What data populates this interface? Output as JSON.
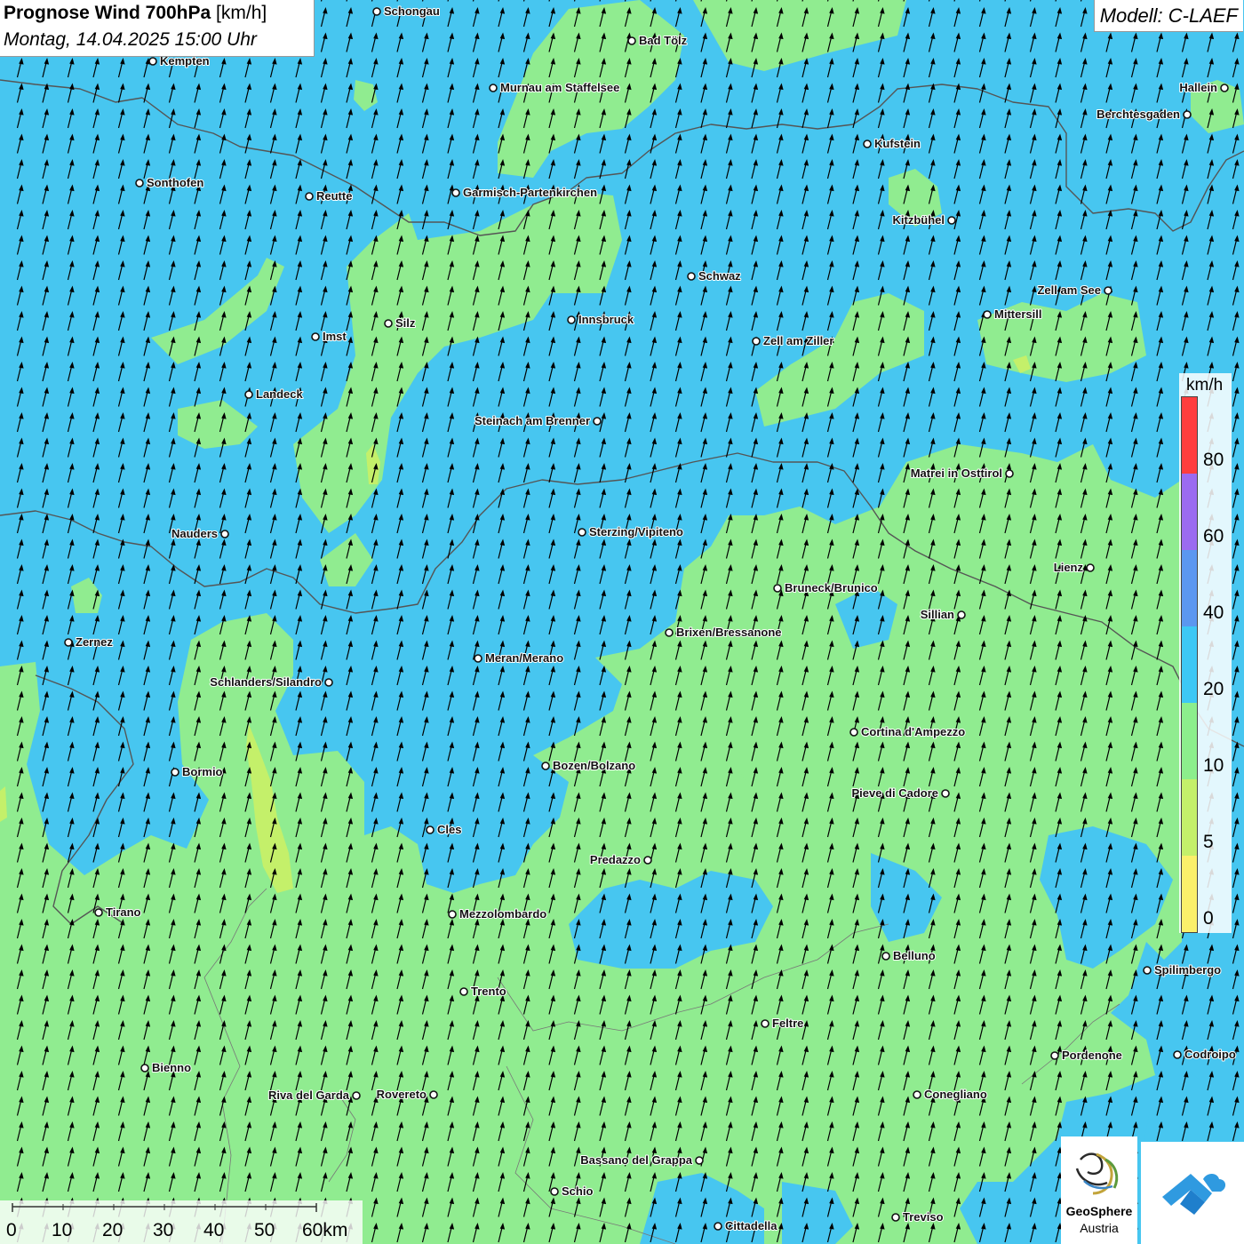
{
  "header": {
    "title_bold": "Prognose Wind 700hPa",
    "title_unit": "[km/h]",
    "datetime": "Montag, 14.04.2025 15:00 Uhr"
  },
  "model_label": "Modell: C-LAEF",
  "legend": {
    "unit": "km/h",
    "labels": [
      "80",
      "60",
      "40",
      "20",
      "10",
      "5",
      "0"
    ],
    "colors": [
      "#ff3d3d",
      "#9b6bf0",
      "#5b97f0",
      "#3dc8f5",
      "#8cee8c",
      "#c4f06a",
      "#fbf06a"
    ]
  },
  "scalebar": {
    "labels": [
      "0",
      "10",
      "20",
      "30",
      "40",
      "50",
      "60km"
    ]
  },
  "logo": {
    "name": "GeoSphere",
    "sub": "Austria"
  },
  "cities": [
    {
      "name": "Schongau"
    },
    {
      "name": "Bad Tölz"
    },
    {
      "name": "Kempten"
    },
    {
      "name": "Murnau am Staffelsee"
    },
    {
      "name": "Hallein"
    },
    {
      "name": "Berchtesgaden"
    },
    {
      "name": "Kufstein"
    },
    {
      "name": "Sonthofen"
    },
    {
      "name": "Reutte"
    },
    {
      "name": "Garmisch-Partenkirchen"
    },
    {
      "name": "Kitzbühel"
    },
    {
      "name": "Schwaz"
    },
    {
      "name": "Zell am See"
    },
    {
      "name": "Innsbruck"
    },
    {
      "name": "Mittersill"
    },
    {
      "name": "Silz"
    },
    {
      "name": "Imst"
    },
    {
      "name": "Zell am Ziller"
    },
    {
      "name": "Landeck"
    },
    {
      "name": "Steinach am Brenner"
    },
    {
      "name": "Matrei in Osttirol"
    },
    {
      "name": "Nauders"
    },
    {
      "name": "Sterzing/Vipiteno"
    },
    {
      "name": "Lienz"
    },
    {
      "name": "Bruneck/Brunico"
    },
    {
      "name": "Sillian"
    },
    {
      "name": "Brixen/Bressanone"
    },
    {
      "name": "Zernez"
    },
    {
      "name": "Meran/Merano"
    },
    {
      "name": "Schlanders/Silandro"
    },
    {
      "name": "Cortina d'Ampezzo"
    },
    {
      "name": "Bozen/Bolzano"
    },
    {
      "name": "Bormio"
    },
    {
      "name": "Pieve di Cadore"
    },
    {
      "name": "Cles"
    },
    {
      "name": "Predazzo"
    },
    {
      "name": "Tirano"
    },
    {
      "name": "Mezzolombardo"
    },
    {
      "name": "Belluno"
    },
    {
      "name": "Spilimbergo"
    },
    {
      "name": "Trento"
    },
    {
      "name": "Feltre"
    },
    {
      "name": "Pordenone"
    },
    {
      "name": "Codroipo"
    },
    {
      "name": "Bienno"
    },
    {
      "name": "Riva del Garda"
    },
    {
      "name": "Rovereto"
    },
    {
      "name": "Conegliano"
    },
    {
      "name": "Bassano del Grappa"
    },
    {
      "name": "Schio"
    },
    {
      "name": "Treviso"
    },
    {
      "name": "Cittadella"
    }
  ]
}
